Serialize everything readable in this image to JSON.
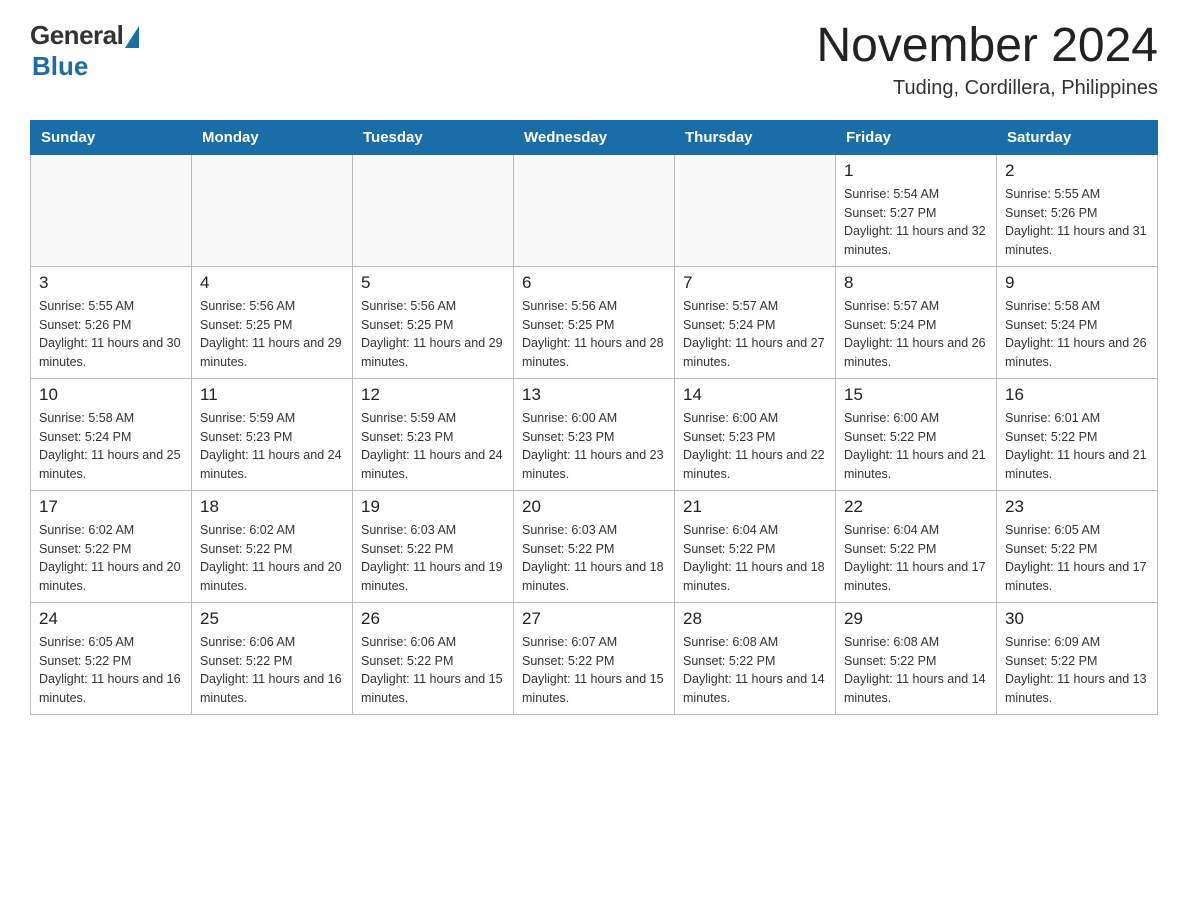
{
  "logo": {
    "general": "General",
    "blue": "Blue"
  },
  "title": "November 2024",
  "location": "Tuding, Cordillera, Philippines",
  "weekdays": [
    "Sunday",
    "Monday",
    "Tuesday",
    "Wednesday",
    "Thursday",
    "Friday",
    "Saturday"
  ],
  "weeks": [
    [
      {
        "day": "",
        "info": ""
      },
      {
        "day": "",
        "info": ""
      },
      {
        "day": "",
        "info": ""
      },
      {
        "day": "",
        "info": ""
      },
      {
        "day": "",
        "info": ""
      },
      {
        "day": "1",
        "info": "Sunrise: 5:54 AM\nSunset: 5:27 PM\nDaylight: 11 hours and 32 minutes."
      },
      {
        "day": "2",
        "info": "Sunrise: 5:55 AM\nSunset: 5:26 PM\nDaylight: 11 hours and 31 minutes."
      }
    ],
    [
      {
        "day": "3",
        "info": "Sunrise: 5:55 AM\nSunset: 5:26 PM\nDaylight: 11 hours and 30 minutes."
      },
      {
        "day": "4",
        "info": "Sunrise: 5:56 AM\nSunset: 5:25 PM\nDaylight: 11 hours and 29 minutes."
      },
      {
        "day": "5",
        "info": "Sunrise: 5:56 AM\nSunset: 5:25 PM\nDaylight: 11 hours and 29 minutes."
      },
      {
        "day": "6",
        "info": "Sunrise: 5:56 AM\nSunset: 5:25 PM\nDaylight: 11 hours and 28 minutes."
      },
      {
        "day": "7",
        "info": "Sunrise: 5:57 AM\nSunset: 5:24 PM\nDaylight: 11 hours and 27 minutes."
      },
      {
        "day": "8",
        "info": "Sunrise: 5:57 AM\nSunset: 5:24 PM\nDaylight: 11 hours and 26 minutes."
      },
      {
        "day": "9",
        "info": "Sunrise: 5:58 AM\nSunset: 5:24 PM\nDaylight: 11 hours and 26 minutes."
      }
    ],
    [
      {
        "day": "10",
        "info": "Sunrise: 5:58 AM\nSunset: 5:24 PM\nDaylight: 11 hours and 25 minutes."
      },
      {
        "day": "11",
        "info": "Sunrise: 5:59 AM\nSunset: 5:23 PM\nDaylight: 11 hours and 24 minutes."
      },
      {
        "day": "12",
        "info": "Sunrise: 5:59 AM\nSunset: 5:23 PM\nDaylight: 11 hours and 24 minutes."
      },
      {
        "day": "13",
        "info": "Sunrise: 6:00 AM\nSunset: 5:23 PM\nDaylight: 11 hours and 23 minutes."
      },
      {
        "day": "14",
        "info": "Sunrise: 6:00 AM\nSunset: 5:23 PM\nDaylight: 11 hours and 22 minutes."
      },
      {
        "day": "15",
        "info": "Sunrise: 6:00 AM\nSunset: 5:22 PM\nDaylight: 11 hours and 21 minutes."
      },
      {
        "day": "16",
        "info": "Sunrise: 6:01 AM\nSunset: 5:22 PM\nDaylight: 11 hours and 21 minutes."
      }
    ],
    [
      {
        "day": "17",
        "info": "Sunrise: 6:02 AM\nSunset: 5:22 PM\nDaylight: 11 hours and 20 minutes."
      },
      {
        "day": "18",
        "info": "Sunrise: 6:02 AM\nSunset: 5:22 PM\nDaylight: 11 hours and 20 minutes."
      },
      {
        "day": "19",
        "info": "Sunrise: 6:03 AM\nSunset: 5:22 PM\nDaylight: 11 hours and 19 minutes."
      },
      {
        "day": "20",
        "info": "Sunrise: 6:03 AM\nSunset: 5:22 PM\nDaylight: 11 hours and 18 minutes."
      },
      {
        "day": "21",
        "info": "Sunrise: 6:04 AM\nSunset: 5:22 PM\nDaylight: 11 hours and 18 minutes."
      },
      {
        "day": "22",
        "info": "Sunrise: 6:04 AM\nSunset: 5:22 PM\nDaylight: 11 hours and 17 minutes."
      },
      {
        "day": "23",
        "info": "Sunrise: 6:05 AM\nSunset: 5:22 PM\nDaylight: 11 hours and 17 minutes."
      }
    ],
    [
      {
        "day": "24",
        "info": "Sunrise: 6:05 AM\nSunset: 5:22 PM\nDaylight: 11 hours and 16 minutes."
      },
      {
        "day": "25",
        "info": "Sunrise: 6:06 AM\nSunset: 5:22 PM\nDaylight: 11 hours and 16 minutes."
      },
      {
        "day": "26",
        "info": "Sunrise: 6:06 AM\nSunset: 5:22 PM\nDaylight: 11 hours and 15 minutes."
      },
      {
        "day": "27",
        "info": "Sunrise: 6:07 AM\nSunset: 5:22 PM\nDaylight: 11 hours and 15 minutes."
      },
      {
        "day": "28",
        "info": "Sunrise: 6:08 AM\nSunset: 5:22 PM\nDaylight: 11 hours and 14 minutes."
      },
      {
        "day": "29",
        "info": "Sunrise: 6:08 AM\nSunset: 5:22 PM\nDaylight: 11 hours and 14 minutes."
      },
      {
        "day": "30",
        "info": "Sunrise: 6:09 AM\nSunset: 5:22 PM\nDaylight: 11 hours and 13 minutes."
      }
    ]
  ]
}
